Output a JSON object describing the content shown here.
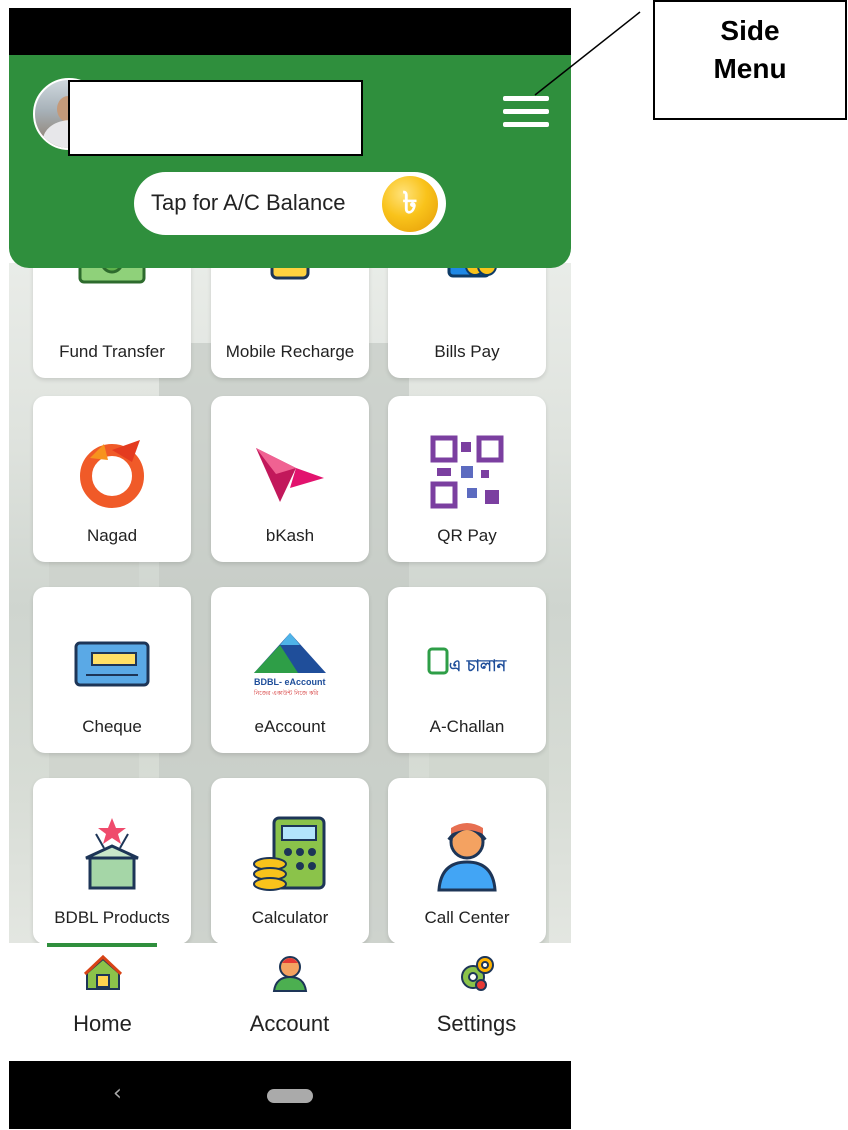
{
  "header": {
    "balance_label": "Tap for A/C Balance",
    "balance_icon": "taka-coin-icon",
    "menu_icon": "hamburger-menu-icon"
  },
  "services": [
    {
      "label": "Fund Transfer",
      "icon": "cash-transfer-icon"
    },
    {
      "label": "Mobile Recharge",
      "icon": "mobile-phone-icon"
    },
    {
      "label": "Bills Pay",
      "icon": "wallet-coins-icon"
    },
    {
      "label": "Nagad",
      "icon": "nagad-logo-icon"
    },
    {
      "label": "bKash",
      "icon": "bkash-bird-icon"
    },
    {
      "label": "QR Pay",
      "icon": "qr-code-icon"
    },
    {
      "label": "Cheque",
      "icon": "cheque-icon"
    },
    {
      "label": "eAccount",
      "icon": "eaccount-logo-icon",
      "logo_text": "BDBL- eAccount",
      "logo_subtext": "নিজের একাউন্ট নিজে করি"
    },
    {
      "label": "A-Challan",
      "icon": "a-challan-logo-icon",
      "logo_text": "এ চালান"
    },
    {
      "label": "BDBL Products",
      "icon": "gift-box-icon"
    },
    {
      "label": "Calculator",
      "icon": "calculator-coins-icon"
    },
    {
      "label": "Call Center",
      "icon": "headset-agent-icon"
    }
  ],
  "bottom_nav": {
    "tabs": [
      {
        "label": "Home",
        "icon": "home-icon",
        "active": true
      },
      {
        "label": "Account",
        "icon": "user-icon",
        "active": false
      },
      {
        "label": "Settings",
        "icon": "gears-icon",
        "active": false
      }
    ]
  },
  "system_nav": {
    "back_symbol": "‹"
  },
  "annotation": {
    "line1": "Side",
    "line2": "Menu"
  },
  "colors": {
    "brand_green": "#2f8f3d",
    "coin_gold": "#f9c31b"
  }
}
